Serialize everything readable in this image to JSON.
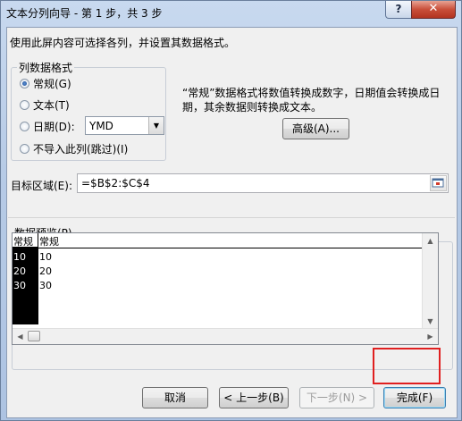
{
  "window": {
    "title": "文本分列向导 - 第 1 步，共 3 步",
    "help_label": "?",
    "close_label": "✕"
  },
  "instruction": "使用此屏内容可选择各列，并设置其数据格式。",
  "column_format": {
    "legend": "列数据格式",
    "options": [
      {
        "label": "常规(G)",
        "selected": true
      },
      {
        "label": "文本(T)",
        "selected": false
      },
      {
        "label": "日期(D):",
        "selected": false
      },
      {
        "label": "不导入此列(跳过)(I)",
        "selected": false
      }
    ],
    "date_format_value": "YMD"
  },
  "description": "“常规”数据格式将数值转换成数字，日期值会转换成日期，其余数据则转换成文本。",
  "advanced_button": "高级(A)...",
  "destination": {
    "label": "目标区域(E):",
    "value": "=$B$2:$C$4"
  },
  "preview": {
    "label": "数据预览(P)",
    "headers": [
      "常规",
      "常规"
    ],
    "rows": [
      [
        "10",
        "10"
      ],
      [
        "20",
        "20"
      ],
      [
        "30",
        "30"
      ]
    ]
  },
  "buttons": {
    "cancel": "取消",
    "back": "< 上一步(B)",
    "next": "下一步(N) >",
    "finish": "完成(F)"
  },
  "colors": {
    "highlight": "#e02020",
    "selected_column": "#000000"
  }
}
